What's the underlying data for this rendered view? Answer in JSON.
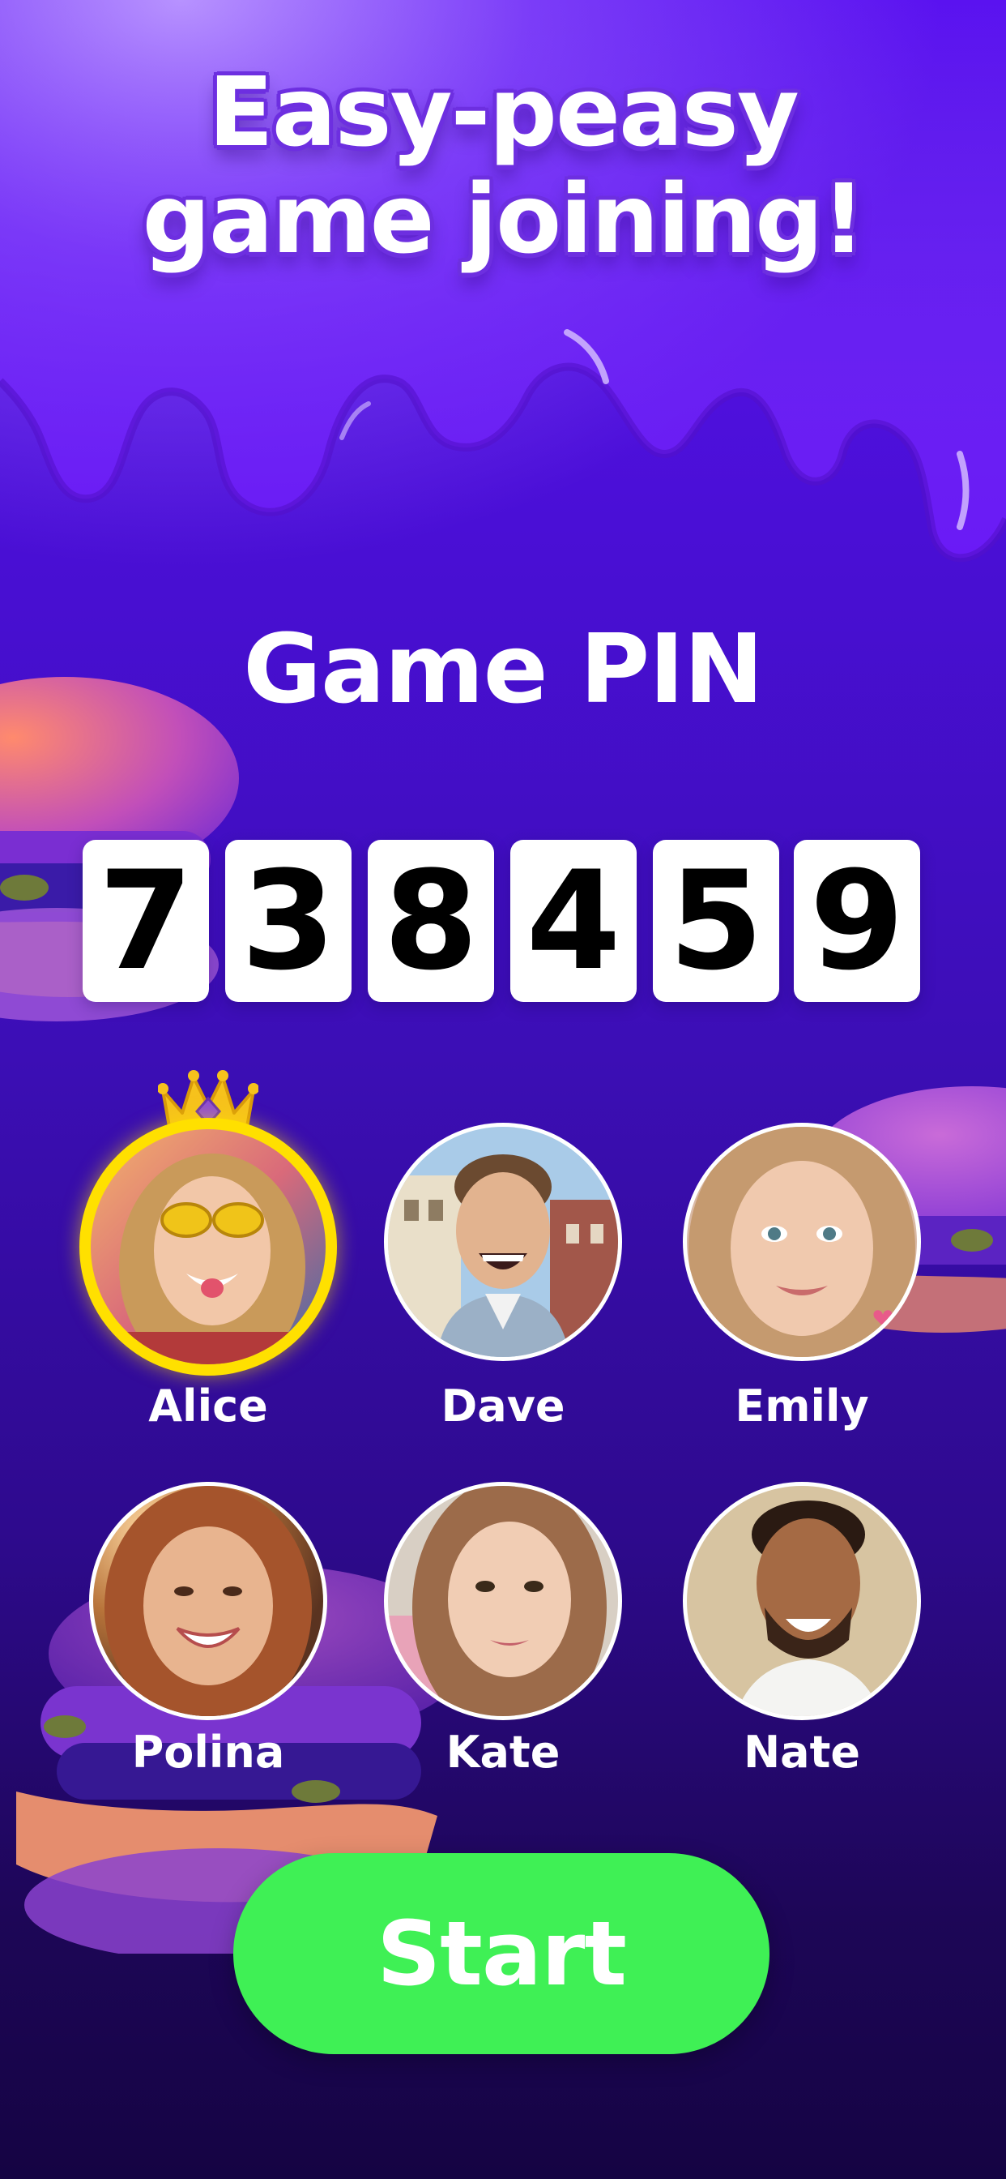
{
  "headline": {
    "line1": "Easy-peasy",
    "line2": "game joining!"
  },
  "pin": {
    "label": "Game PIN",
    "digits": [
      "7",
      "3",
      "8",
      "4",
      "5",
      "9"
    ]
  },
  "players": [
    {
      "name": "Alice",
      "host": true
    },
    {
      "name": "Dave",
      "host": false
    },
    {
      "name": "Emily",
      "host": false
    },
    {
      "name": "Polina",
      "host": false
    },
    {
      "name": "Kate",
      "host": false
    },
    {
      "name": "Nate",
      "host": false
    }
  ],
  "start_button": {
    "label": "Start"
  },
  "colors": {
    "accent_purple": "#4a0fd6",
    "start_green": "#3ff055",
    "host_ring_yellow": "#ffe000",
    "crown_gold": "#f6c21c",
    "crown_gem": "#8e4bd6"
  },
  "icons": {
    "crown": "crown-icon"
  }
}
